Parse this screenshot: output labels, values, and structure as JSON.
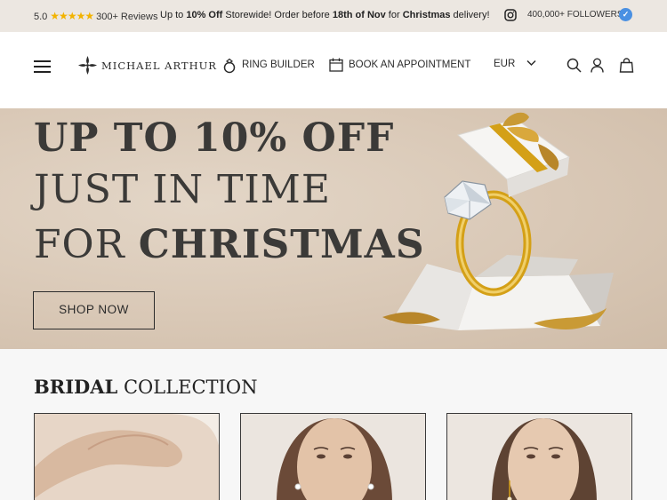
{
  "topbar": {
    "rating_value": "5.0",
    "stars": "★★★★★",
    "reviews": "300+ Reviews",
    "msg_pre": "Up to ",
    "msg_bold1": "10% Off",
    "msg_mid": " Storewide! Order before ",
    "msg_bold2": "18th of Nov",
    "msg_mid2": " for ",
    "msg_bold3": "Christmas",
    "msg_post": " delivery!",
    "followers": "400,000+ FOLLOWERS",
    "verified_icon": "✓"
  },
  "header": {
    "logo_text": "MICHAEL ARTHUR",
    "ring_builder": "RING BUILDER",
    "book_appointment": "BOOK AN APPOINTMENT",
    "currency": "EUR"
  },
  "hero": {
    "line1": "UP TO 10% OFF",
    "line2": "JUST IN TIME",
    "line3_pre": "FOR ",
    "line3_bold": "CHRISTMAS",
    "cta": "SHOP NOW"
  },
  "bridal": {
    "title_bold": "BRIDAL",
    "title_rest": " COLLECTION"
  },
  "colors": {
    "accent_gold": "#d4a017",
    "hero_bg": "#d9c8b6",
    "text_dark": "#3b3a38",
    "star": "#f2b300",
    "verified": "#4a90e2"
  }
}
